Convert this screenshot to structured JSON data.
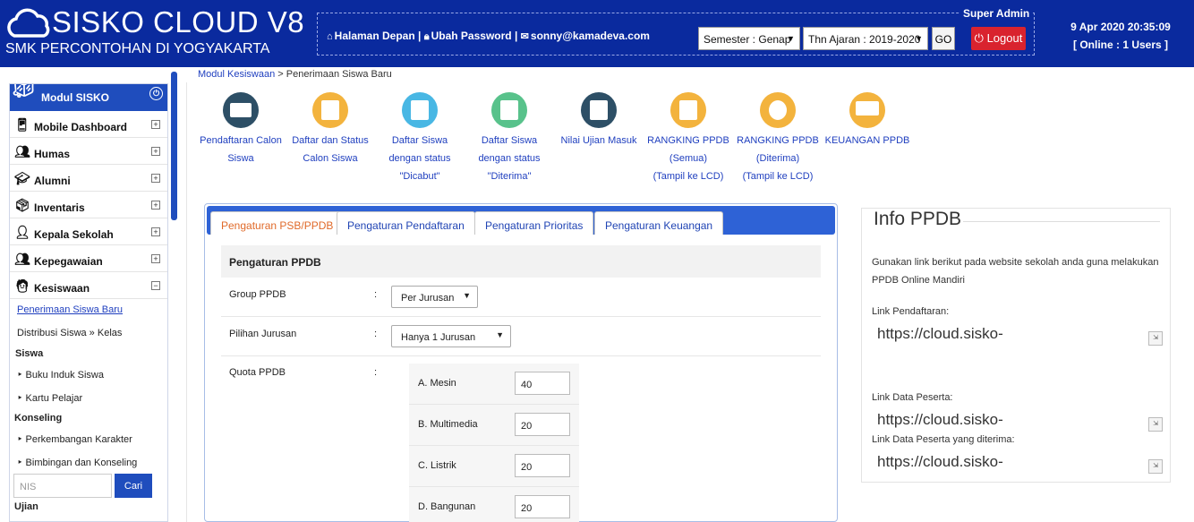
{
  "header": {
    "brand": "SISKO CLOUD V8",
    "school": "SMK PERCONTOHAN DI YOGYAKARTA",
    "role": "Super Admin",
    "links": [
      {
        "icon": "home-icon",
        "label": "Halaman Depan"
      },
      {
        "icon": "lock-icon",
        "label": "Ubah Password"
      },
      {
        "icon": "envelope-icon",
        "label": "sonny@kamadeva.com"
      }
    ],
    "semester": "Semester : Genap",
    "tahun": "Thn Ajaran : 2019-2020",
    "go_label": "GO",
    "logout_label": "Logout",
    "datetime": "9 Apr 2020 20:35:09",
    "online": "[ Online : 1 Users ]"
  },
  "sidebar": {
    "title": "Modul SISKO",
    "items": [
      {
        "label": "Mobile Dashboard",
        "icon": "mobile-icon",
        "toggle": "+"
      },
      {
        "label": "Humas",
        "icon": "people-icon",
        "toggle": "+"
      },
      {
        "label": "Alumni",
        "icon": "alumni-icon",
        "toggle": "+"
      },
      {
        "label": "Inventaris",
        "icon": "boxes-icon",
        "toggle": "+"
      },
      {
        "label": "Kepala Sekolah",
        "icon": "principal-icon",
        "toggle": "+"
      },
      {
        "label": "Kepegawaian",
        "icon": "staff-icon",
        "toggle": "+"
      },
      {
        "label": "Kesiswaan",
        "icon": "student-icon",
        "toggle": "−"
      }
    ],
    "sub": {
      "penerimaan": "Penerimaan Siswa Baru",
      "distribusi": "Distribusi Siswa » Kelas",
      "siswa_group": "Siswa",
      "buku_induk": "‣ Buku Induk Siswa",
      "kartu": "‣ Kartu Pelajar",
      "konseling_group": "Konseling",
      "perkembangan": "‣ Perkembangan Karakter",
      "bimbingan": "‣ Bimbingan dan Konseling",
      "nis_placeholder": "NIS",
      "cari": "Cari",
      "ujian_group": "Ujian"
    }
  },
  "breadcrumb": {
    "parent": "Modul Kesiswaan",
    "sep": " > ",
    "current": "Penerimaan Siswa Baru"
  },
  "shortcuts": [
    {
      "icon": "registration-icon",
      "color": "#2d4f66",
      "lines": [
        "Pendaftaran Calon",
        "Siswa"
      ]
    },
    {
      "icon": "list-status-icon",
      "color": "#f3b33d",
      "lines": [
        "Daftar dan Status",
        "Calon Siswa"
      ]
    },
    {
      "icon": "revoked-icon",
      "color": "#48b7e4",
      "lines": [
        "Daftar Siswa",
        "dengan status",
        "\"Dicabut\""
      ]
    },
    {
      "icon": "accepted-icon",
      "color": "#58c28b",
      "lines": [
        "Daftar Siswa",
        "dengan status",
        "\"Diterima\""
      ]
    },
    {
      "icon": "exam-score-icon",
      "color": "#2d4f66",
      "lines": [
        "Nilai Ujian Masuk"
      ]
    },
    {
      "icon": "ranking-all-icon",
      "color": "#f3b33d",
      "lines": [
        "RANGKING PPDB",
        "(Semua)",
        "(Tampil ke LCD)"
      ]
    },
    {
      "icon": "ranking-accepted-icon",
      "color": "#f3b33d",
      "lines": [
        "RANGKING PPDB",
        "(Diterima)",
        "(Tampil ke LCD)"
      ]
    },
    {
      "icon": "finance-icon",
      "color": "#f3b33d",
      "lines": [
        "KEUANGAN PPDB"
      ]
    }
  ],
  "tabs": [
    "Pengaturan PSB/PPDB",
    "Pengaturan Pendaftaran",
    "Pengaturan Prioritas",
    "Pengaturan Keuangan"
  ],
  "form": {
    "heading": "Pengaturan PPDB",
    "colon": ":",
    "group_label": "Group PPDB",
    "group_value": "Per Jurusan",
    "pilihan_label": "Pilihan Jurusan",
    "pilihan_value": "Hanya 1 Jurusan",
    "quota_label": "Quota PPDB",
    "quota": [
      {
        "label": "A. Mesin",
        "value": "40"
      },
      {
        "label": "B. Multimedia",
        "value": "20"
      },
      {
        "label": "C. Listrik",
        "value": "20"
      },
      {
        "label": "D. Bangunan",
        "value": "20"
      }
    ]
  },
  "info": {
    "title": "Info PPDB",
    "desc": "Gunakan link berikut pada website sekolah anda guna melakukan PPDB Online Mandiri",
    "link1_label": "Link Pendaftaran:",
    "link1_value": "https://cloud.sisko-",
    "link2_label": "Link Data Peserta:",
    "link2_value": "https://cloud.sisko-",
    "link3_label": "Link Data Peserta yang diterima:",
    "link3_value": "https://cloud.sisko-"
  }
}
